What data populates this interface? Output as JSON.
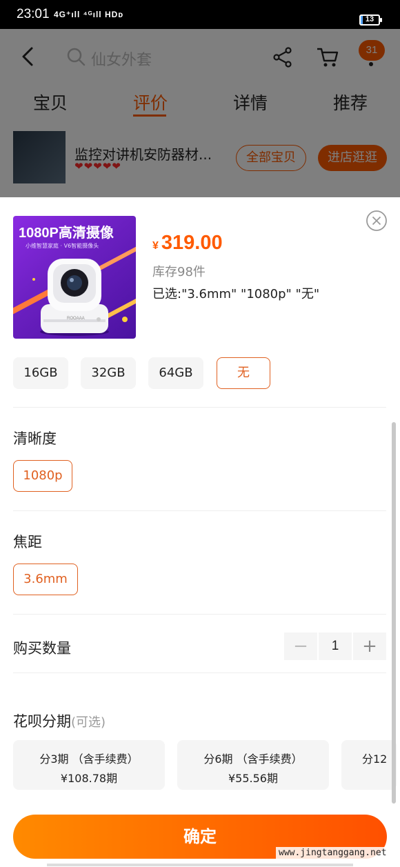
{
  "status_bar": {
    "time": "23:01",
    "signal": "4G⁺ıll ⁴ᴳıll HDᴅ",
    "battery_level": 13,
    "battery_text": "13"
  },
  "nav": {
    "search_placeholder": "仙女外套",
    "cart_badge": "31"
  },
  "tabs": [
    "宝贝",
    "评价",
    "详情",
    "推荐"
  ],
  "active_tab": 1,
  "shop": {
    "name": "监控对讲机安防器材...",
    "hearts": "❤❤❤❤❤",
    "all_items_label": "全部宝贝",
    "enter_store_label": "进店逛逛"
  },
  "product": {
    "image_title": "1080P高清摄像",
    "image_subtitle": "小维智慧家庭 · V6智能摄像头",
    "currency": "¥",
    "price": "319.00",
    "stock": "库存98件",
    "selected": "已选:\"3.6mm\" \"1080p\" \"无\""
  },
  "storage_options": [
    "16GB",
    "32GB",
    "64GB",
    "无"
  ],
  "storage_selected": 3,
  "resolution": {
    "title": "清晰度",
    "options": [
      "1080p"
    ]
  },
  "focal": {
    "title": "焦距",
    "options": [
      "3.6mm"
    ]
  },
  "quantity": {
    "title": "购买数量",
    "minus": "−",
    "value": "1",
    "plus": "+"
  },
  "installments": {
    "title": "花呗分期",
    "optional": "(可选)",
    "items": [
      {
        "line1": "分3期 （含手续费）",
        "line2": "¥108.78期"
      },
      {
        "line1": "分6期 （含手续费）",
        "line2": "¥55.56期"
      },
      {
        "line1": "分12",
        "line2": ""
      }
    ]
  },
  "confirm_label": "确定",
  "watermark": "www.jingtanggang.net",
  "colors": {
    "accent": "#ff5a00",
    "overlay": "rgba(0,0,0,0.5)"
  }
}
